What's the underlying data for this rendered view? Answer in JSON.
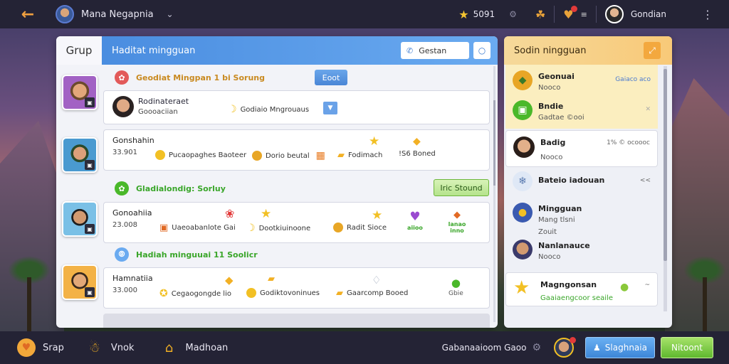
{
  "topbar": {
    "username": "Mana Negapnia",
    "coins": "5091",
    "right_name": "Gondian"
  },
  "main": {
    "tab_label": "Grup",
    "header_title": "Haditat mingguan",
    "search_label": "Gestan",
    "section1": {
      "title": "Geodiat Mingpan 1 bi Sorung",
      "button": "Eoot"
    },
    "card1": {
      "name": "Rodinateraet",
      "sub": "Goooaciian",
      "item": "Godiaio Mngrouaus"
    },
    "card2": {
      "name": "Gonshahin",
      "sub": "33.901",
      "items": [
        "Pucaopaghes Baoteer",
        "Dorio beutal",
        "Fodimach",
        "!S6 Boned"
      ]
    },
    "section2": {
      "title": "Gladialondig: Sorluy",
      "button": "Iric Stound"
    },
    "card3": {
      "name": "Gonoahiia",
      "sub": "23.008",
      "items": [
        "Uaeoabanlote Gai",
        "Dootkiuinoone",
        "Radit Sioce"
      ],
      "tall_items": [
        "aiioo",
        "lanao inno"
      ]
    },
    "section3": {
      "title": "Hadiah minguuai 11 Soolicr"
    },
    "card4": {
      "name": "Hamnatiia",
      "sub": "33.000",
      "items": [
        "Cegaogongde lio",
        "Godiktovoninues",
        "Gaarcomp Booed"
      ],
      "tall_item": "Gbie"
    }
  },
  "right": {
    "title": "Sodin ningguan",
    "rows": [
      {
        "name": "Geonuai",
        "sub": "Nooco",
        "aside": "Gaiaco aco"
      },
      {
        "name": "Bndie",
        "sub": "Gadtae ©ooi"
      },
      {
        "name": "Badig",
        "sub": "Nooco",
        "aside": "1% © ocoooc"
      },
      {
        "name": "Bateio iadouan",
        "aside": "<<"
      },
      {
        "name": "Mingguan",
        "sub": "Mang tlsni",
        "extra": "Zouit"
      },
      {
        "name": "Nanlanauce",
        "sub": "Nooco"
      },
      {
        "name": "Magngonsan",
        "sub": "Gaaiaengcoor seaile",
        "aside": "~"
      }
    ]
  },
  "bottombar": {
    "nav": [
      "Srap",
      "Vnok",
      "Madhoan"
    ],
    "status": "Gabanaaioom Gaoo",
    "blue_button": "Slaghnaia",
    "green_button": "Nitoont"
  }
}
